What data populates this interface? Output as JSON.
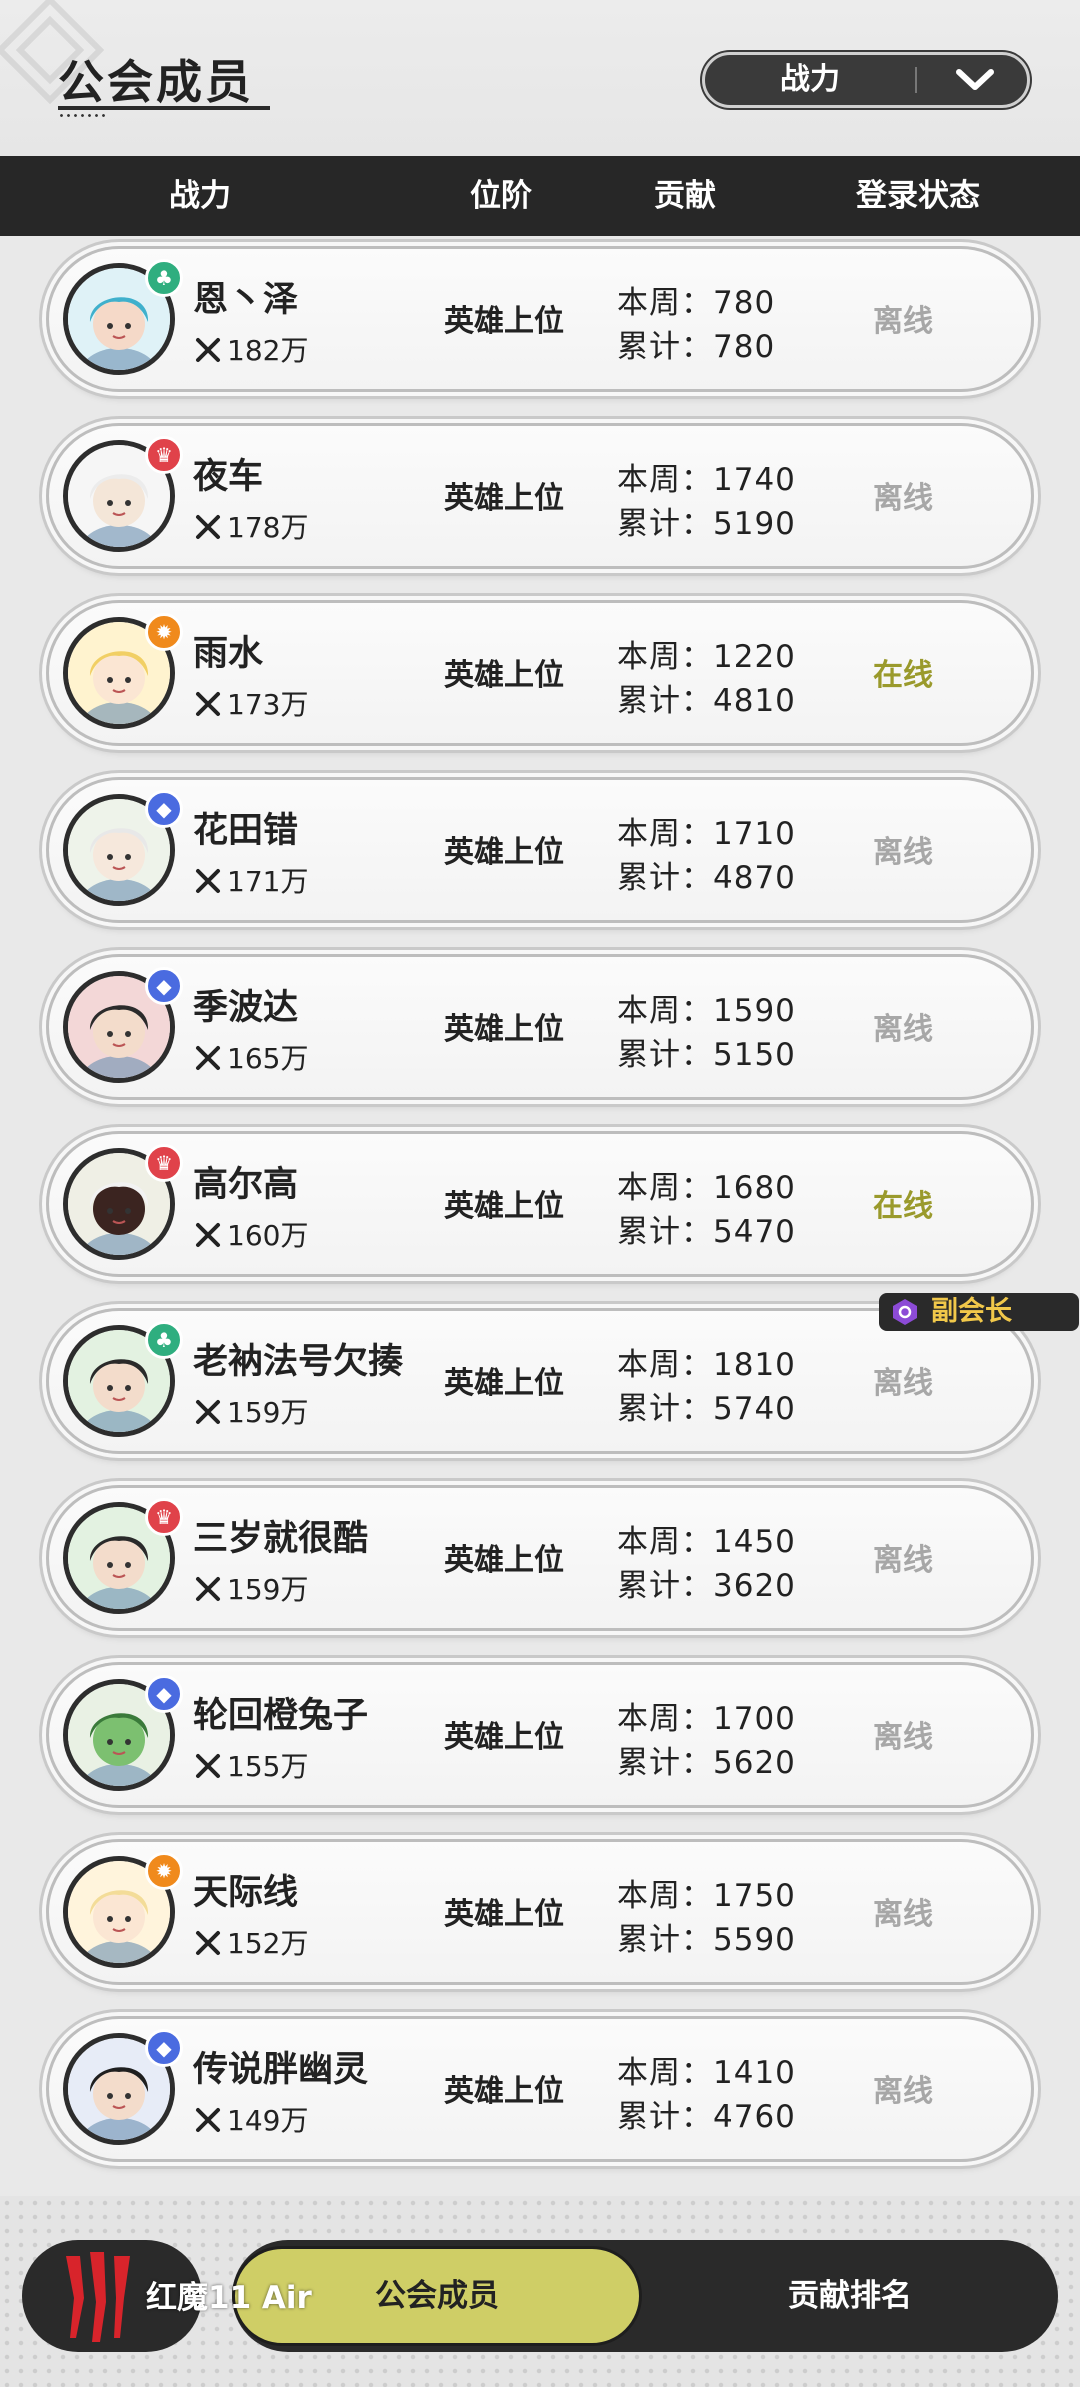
{
  "header": {
    "title": "公会成员",
    "sort_select": {
      "value": "战力"
    }
  },
  "columns": {
    "power": "战力",
    "rank": "位阶",
    "contribution": "贡献",
    "login_status": "登录状态"
  },
  "labels": {
    "week_prefix": "本周：",
    "total_prefix": "累计："
  },
  "members": [
    {
      "name": "恩丶泽",
      "power": "182万",
      "rank": "英雄上位",
      "week": "780",
      "total": "780",
      "status": "离线",
      "online": false,
      "badge_color": "#2fae7f",
      "badge_icon": "leaf-icon",
      "avatar_hair": "#3fb0cc",
      "avatar_skin": "#f5d9c8",
      "avatar_bg": "#dff2f7"
    },
    {
      "name": "夜车",
      "power": "178万",
      "rank": "英雄上位",
      "week": "1740",
      "total": "5190",
      "status": "离线",
      "online": false,
      "badge_color": "#e0424a",
      "badge_icon": "crown-icon",
      "avatar_hair": "#ececec",
      "avatar_skin": "#f4e6d8",
      "avatar_bg": "#f6f6f6"
    },
    {
      "name": "雨水",
      "power": "173万",
      "rank": "英雄上位",
      "week": "1220",
      "total": "4810",
      "status": "在线",
      "online": true,
      "badge_color": "#f08a1c",
      "badge_icon": "flame-icon",
      "avatar_hair": "#f1cf64",
      "avatar_skin": "#fbe6d3",
      "avatar_bg": "#fff3cf"
    },
    {
      "name": "花田错",
      "power": "171万",
      "rank": "英雄上位",
      "week": "1710",
      "total": "4870",
      "status": "离线",
      "online": false,
      "badge_color": "#4a6be0",
      "badge_icon": "shield-icon",
      "avatar_hair": "#e8e8e8",
      "avatar_skin": "#f6e8dc",
      "avatar_bg": "#eef3ea"
    },
    {
      "name": "季波达",
      "power": "165万",
      "rank": "英雄上位",
      "week": "1590",
      "total": "5150",
      "status": "离线",
      "online": false,
      "badge_color": "#4a6be0",
      "badge_icon": "shield-icon",
      "avatar_hair": "#2b2b2b",
      "avatar_skin": "#f3dccb",
      "avatar_bg": "#f3d7d7"
    },
    {
      "name": "高尔高",
      "power": "160万",
      "rank": "英雄上位",
      "week": "1680",
      "total": "5470",
      "status": "在线",
      "online": true,
      "badge_color": "#e0424a",
      "badge_icon": "crown-icon",
      "avatar_hair": "#f2f2f2",
      "avatar_skin": "#3b2420",
      "avatar_bg": "#efefe5"
    },
    {
      "name": "老衲法号欠揍",
      "power": "159万",
      "rank": "英雄上位",
      "week": "1810",
      "total": "5740",
      "status": "离线",
      "online": false,
      "badge_color": "#2fae7f",
      "badge_icon": "leaf-icon",
      "avatar_hair": "#2a2a2a",
      "avatar_skin": "#f3dccb",
      "avatar_bg": "#e3f2e1",
      "role": "副会长"
    },
    {
      "name": "三岁就很酷",
      "power": "159万",
      "rank": "英雄上位",
      "week": "1450",
      "total": "3620",
      "status": "离线",
      "online": false,
      "badge_color": "#e0424a",
      "badge_icon": "crown-icon",
      "avatar_hair": "#2a2a2a",
      "avatar_skin": "#f3dccb",
      "avatar_bg": "#e3f2e1"
    },
    {
      "name": "轮回橙兔子",
      "power": "155万",
      "rank": "英雄上位",
      "week": "1700",
      "total": "5620",
      "status": "离线",
      "online": false,
      "badge_color": "#4a6be0",
      "badge_icon": "shield-icon",
      "avatar_hair": "#3a7a3a",
      "avatar_skin": "#7cc070",
      "avatar_bg": "#e9f1e4"
    },
    {
      "name": "天际线",
      "power": "152万",
      "rank": "英雄上位",
      "week": "1750",
      "total": "5590",
      "status": "离线",
      "online": false,
      "badge_color": "#f08a1c",
      "badge_icon": "flame-icon",
      "avatar_hair": "#f3dc98",
      "avatar_skin": "#fbe6d3",
      "avatar_bg": "#fff4dc"
    },
    {
      "name": "传说胖幽灵",
      "power": "149万",
      "rank": "英雄上位",
      "week": "1410",
      "total": "4760",
      "status": "离线",
      "online": false,
      "badge_color": "#4a6be0",
      "badge_icon": "shield-icon",
      "avatar_hair": "#1f1f1f",
      "avatar_skin": "#f3dccb",
      "avatar_bg": "#e7ecf7"
    }
  ],
  "bottom_nav": {
    "brand": "红魔11 Air",
    "tabs": [
      {
        "label": "公会成员",
        "active": true
      },
      {
        "label": "贡献排名",
        "active": false
      }
    ]
  },
  "colors": {
    "header_bar": "#272727",
    "online": "#9a9a2c",
    "offline": "#a7a7a7",
    "active_tab": "#cfce66",
    "role_tag_text": "#f1c84a"
  }
}
